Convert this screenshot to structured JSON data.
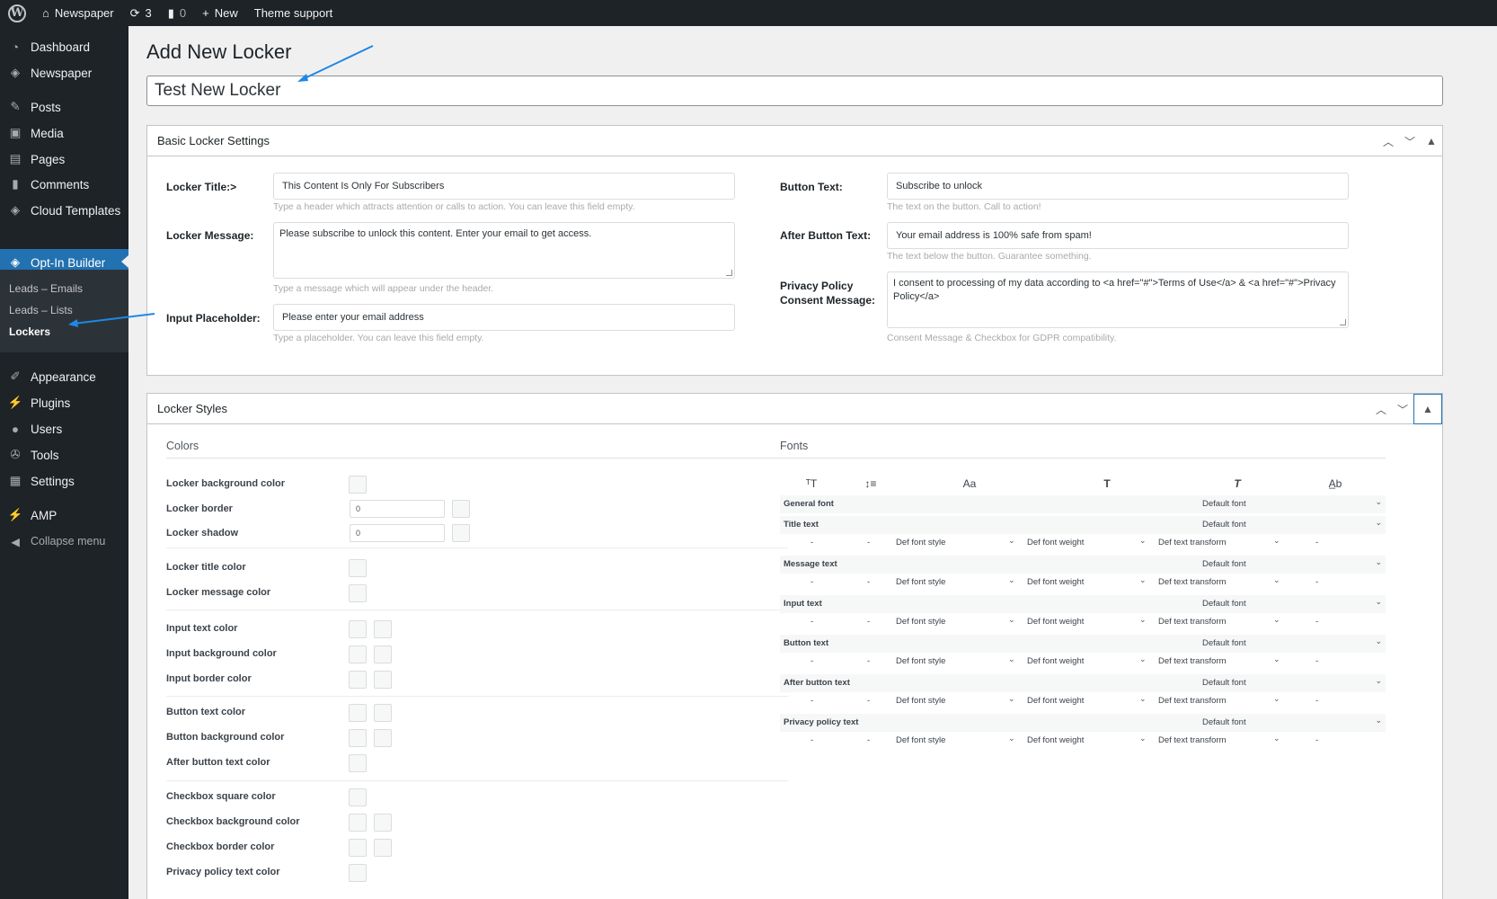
{
  "adminbar": {
    "site_name": "Newspaper",
    "updates_count": "3",
    "comments_count": "0",
    "new_label": "New",
    "theme_support_label": "Theme support"
  },
  "sidebar": {
    "items": [
      {
        "label": "Dashboard",
        "icon": "dashboard-icon"
      },
      {
        "label": "Newspaper",
        "icon": "newspaper-icon"
      },
      {
        "label": "Posts",
        "icon": "pin-icon"
      },
      {
        "label": "Media",
        "icon": "media-icon"
      },
      {
        "label": "Pages",
        "icon": "pages-icon"
      },
      {
        "label": "Comments",
        "icon": "comments-icon"
      },
      {
        "label": "Cloud Templates",
        "icon": "cloud-templates-icon"
      },
      {
        "label": "Opt-In Builder",
        "icon": "optin-icon"
      },
      {
        "label": "Appearance",
        "icon": "brush-icon"
      },
      {
        "label": "Plugins",
        "icon": "plugins-icon"
      },
      {
        "label": "Users",
        "icon": "users-icon"
      },
      {
        "label": "Tools",
        "icon": "wrench-icon"
      },
      {
        "label": "Settings",
        "icon": "settings-icon"
      },
      {
        "label": "AMP",
        "icon": "amp-icon"
      },
      {
        "label": "Collapse menu",
        "icon": "collapse-icon"
      }
    ],
    "submenu": [
      "Leads – Emails",
      "Leads – Lists",
      "Lockers"
    ]
  },
  "page": {
    "title": "Add New Locker",
    "locker_name": "Test New Locker"
  },
  "basic": {
    "header": "Basic Locker Settings",
    "locker_title_label": "Locker Title:>",
    "locker_title_value": "This Content Is Only For Subscribers",
    "locker_title_hint": "Type a header which attracts attention or calls to action. You can leave this field empty.",
    "locker_message_label": "Locker Message:",
    "locker_message_value": "Please subscribe to unlock this content. Enter your email to get access.",
    "locker_message_hint": "Type a message which will appear under the header.",
    "input_placeholder_label": "Input Placeholder:",
    "input_placeholder_value": "Please enter your email address",
    "input_placeholder_hint": "Type a placeholder. You can leave this field empty.",
    "button_text_label": "Button Text:",
    "button_text_value": "Subscribe to unlock",
    "button_text_hint": "The text on the button. Call to action!",
    "after_button_label": "After Button Text:",
    "after_button_value": "Your email address is 100% safe from spam!",
    "after_button_hint": "The text below the button. Guarantee something.",
    "privacy_label_1": "Privacy Policy",
    "privacy_label_2": "Consent Message:",
    "privacy_value": "I consent to processing of my data according to <a href=\"#\">Terms of Use</a> & <a href=\"#\">Privacy Policy</a>",
    "privacy_hint": "Consent Message & Checkbox for GDPR compatibility."
  },
  "styles": {
    "header": "Locker Styles",
    "colors_title": "Colors",
    "fonts_title": "Fonts",
    "colors": {
      "bg": "Locker background color",
      "border": "Locker border",
      "border_value": "0",
      "shadow": "Locker shadow",
      "shadow_value": "0",
      "title": "Locker title color",
      "message": "Locker message color",
      "input_text": "Input text color",
      "input_bg": "Input background color",
      "input_border": "Input border color",
      "button_text": "Button text color",
      "button_bg": "Button background color",
      "after_button": "After button text color",
      "checkbox_square": "Checkbox square color",
      "checkbox_bg": "Checkbox background color",
      "checkbox_border": "Checkbox border color",
      "privacy_text": "Privacy policy text color"
    },
    "font_icons": {
      "size": "ᵀT",
      "line_height": "↕≡",
      "family": "Aa",
      "weight": "T",
      "style": "T",
      "transform": "A̲b"
    },
    "font_general_label": "General font",
    "default_font": "Default font",
    "dash": "-",
    "def_font_style": "Def font style",
    "def_font_weight": "Def font weight",
    "def_text_transform": "Def text transform",
    "font_rows": [
      "Title text",
      "Message text",
      "Input text",
      "Button text",
      "After button text",
      "Privacy policy text"
    ]
  },
  "colors": {
    "accent": "#2271b1",
    "sidebar_bg": "#1d2327",
    "arrow": "#1e88e5"
  }
}
